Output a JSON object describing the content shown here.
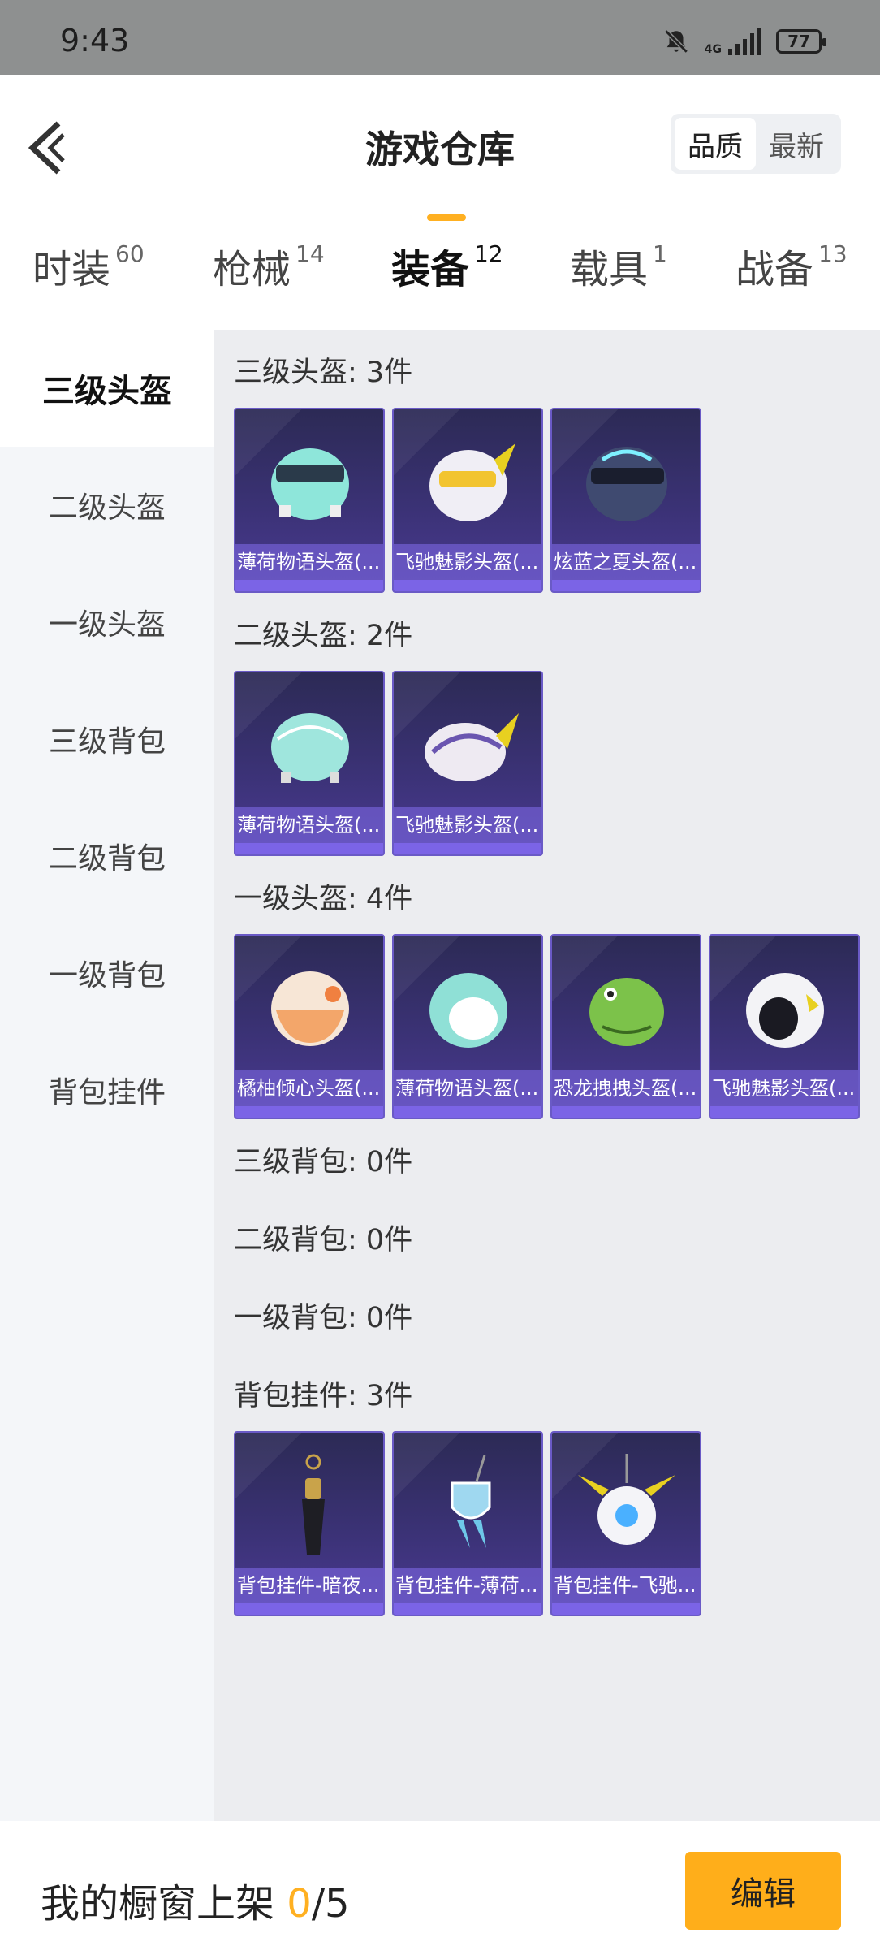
{
  "status": {
    "time": "9:43",
    "network": "4G",
    "battery": "77"
  },
  "header": {
    "title": "游戏仓库",
    "sort_quality": "品质",
    "sort_newest": "最新"
  },
  "tabs": [
    {
      "label": "时装",
      "count": "60"
    },
    {
      "label": "枪械",
      "count": "14"
    },
    {
      "label": "装备",
      "count": "12"
    },
    {
      "label": "载具",
      "count": "1"
    },
    {
      "label": "战备",
      "count": "13"
    }
  ],
  "sidebar": {
    "items": [
      {
        "label": "三级头盔"
      },
      {
        "label": "二级头盔"
      },
      {
        "label": "一级头盔"
      },
      {
        "label": "三级背包"
      },
      {
        "label": "二级背包"
      },
      {
        "label": "一级背包"
      },
      {
        "label": "背包挂件"
      }
    ]
  },
  "sections": [
    {
      "title": "三级头盔: 3件",
      "items": [
        {
          "name": "薄荷物语头盔(...",
          "icon": "mint-helmet-lv3-icon",
          "color": "#8ee6da"
        },
        {
          "name": "飞驰魅影头盔(...",
          "icon": "racer-helmet-lv3-icon",
          "color": "#f0eef5"
        },
        {
          "name": "炫蓝之夏头盔(...",
          "icon": "blue-summer-helmet-icon",
          "color": "#3f4a70"
        }
      ]
    },
    {
      "title": "二级头盔: 2件",
      "items": [
        {
          "name": "薄荷物语头盔(...",
          "icon": "mint-helmet-lv2-icon",
          "color": "#9fe6dd"
        },
        {
          "name": "飞驰魅影头盔(...",
          "icon": "racer-helmet-lv2-icon",
          "color": "#eeeaf2"
        }
      ]
    },
    {
      "title": "一级头盔: 4件",
      "items": [
        {
          "name": "橘柚倾心头盔(...",
          "icon": "orange-helmet-icon",
          "color": "#f3a66a"
        },
        {
          "name": "薄荷物语头盔(...",
          "icon": "mint-helmet-lv1-icon",
          "color": "#8fe0d6"
        },
        {
          "name": "恐龙拽拽头盔(...",
          "icon": "dino-helmet-icon",
          "color": "#7cc24a"
        },
        {
          "name": "飞驰魅影头盔(...",
          "icon": "racer-helmet-lv1-icon",
          "color": "#f3f3f6"
        }
      ]
    },
    {
      "title": "三级背包: 0件",
      "items": []
    },
    {
      "title": "二级背包: 0件",
      "items": []
    },
    {
      "title": "一级背包: 0件",
      "items": []
    },
    {
      "title": "背包挂件: 3件",
      "items": [
        {
          "name": "背包挂件-暗夜...",
          "icon": "night-charm-icon",
          "color": "#c9a34a"
        },
        {
          "name": "背包挂件-薄荷...",
          "icon": "mint-charm-icon",
          "color": "#9fd8f0"
        },
        {
          "name": "背包挂件-飞驰...",
          "icon": "racer-charm-icon",
          "color": "#4ab0ff"
        }
      ]
    }
  ],
  "bottom": {
    "shelf_label": "我的橱窗上架",
    "shelf_current": "0",
    "shelf_total": "/5",
    "edit_label": "编辑"
  },
  "colors": {
    "accent": "#ffb021",
    "card_bg": "#3b3276",
    "card_label": "#7b64e6"
  }
}
